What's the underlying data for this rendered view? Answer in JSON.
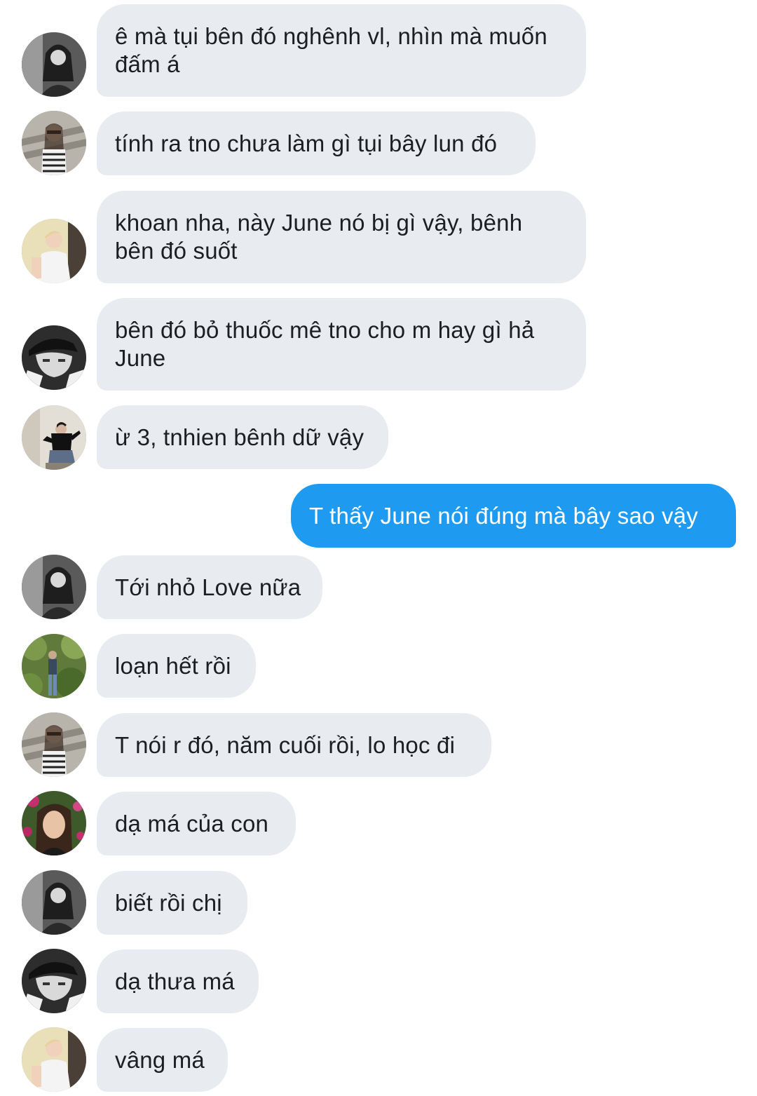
{
  "messages": [
    {
      "sender": "avatar-bw-girl",
      "text": "ê mà tụi bên đó nghênh vl, nhìn mà muốn đấm á"
    },
    {
      "sender": "avatar-stripe-girl",
      "text": "tính ra tno chưa làm gì tụi bây lun đó"
    },
    {
      "sender": "avatar-blond-boy",
      "text": "khoan nha, này June nó bị gì vậy, bênh bên đó suốt"
    },
    {
      "sender": "avatar-cap-boy",
      "text": "bên đó bỏ thuốc mê tno cho m hay gì hả June"
    },
    {
      "sender": "avatar-sitting-boy",
      "text": "ừ 3, tnhien bênh dữ vậy"
    },
    {
      "sender": "me",
      "text": "T thấy June nói đúng mà bây sao vậy"
    },
    {
      "sender": "avatar-bw-girl",
      "text": "Tới nhỏ Love nữa"
    },
    {
      "sender": "avatar-garden-boy",
      "text": "loạn hết rồi"
    },
    {
      "sender": "avatar-stripe-girl",
      "text": "T nói r đó, năm cuối rồi, lo học đi"
    },
    {
      "sender": "avatar-flower-girl",
      "text": "dạ má của con"
    },
    {
      "sender": "avatar-bw-girl",
      "text": "biết rồi chị"
    },
    {
      "sender": "avatar-cap-boy",
      "text": "dạ thưa má"
    },
    {
      "sender": "avatar-blond-boy",
      "text": "vâng má"
    }
  ],
  "colors": {
    "incoming_bubble": "#e8ecf0",
    "outgoing_bubble": "#1e9bf0",
    "incoming_text": "#1c1e21",
    "outgoing_text": "#ffffff"
  }
}
